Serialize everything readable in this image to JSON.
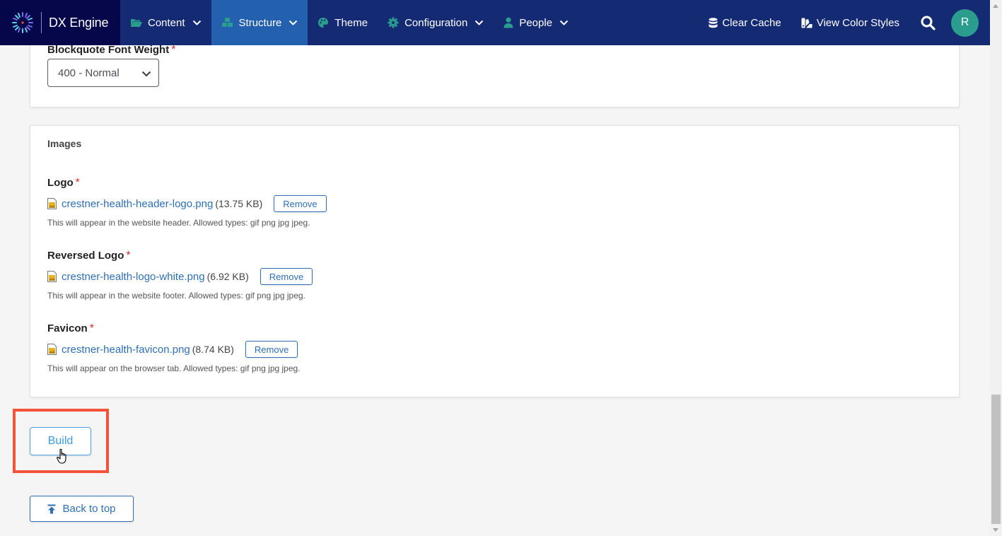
{
  "nav": {
    "brand": "DX Engine",
    "items": [
      {
        "label": "Content",
        "icon": "folder-open-icon",
        "has_dropdown": true,
        "active": false
      },
      {
        "label": "Structure",
        "icon": "cubes-icon",
        "has_dropdown": true,
        "active": true
      },
      {
        "label": "Theme",
        "icon": "palette-icon",
        "has_dropdown": false,
        "active": false
      },
      {
        "label": "Configuration",
        "icon": "gear-icon",
        "has_dropdown": true,
        "active": false
      },
      {
        "label": "People",
        "icon": "user-icon",
        "has_dropdown": true,
        "active": false
      }
    ],
    "clear_cache": "Clear Cache",
    "view_color_styles": "View Color Styles",
    "avatar_initial": "R"
  },
  "colors": {
    "nav_bg": "#142a73",
    "brand_bg": "#06064a",
    "active_nav": "#2360ad",
    "icon_teal": "#2a9d8f",
    "link_blue": "#2e6fb5",
    "required_red": "#d32f2f",
    "highlight_red": "#f4533a"
  },
  "typography_panel": {
    "blockquote_weight_label": "Blockquote Font Weight",
    "blockquote_weight_value": "400 - Normal"
  },
  "images": {
    "title": "Images",
    "fields": [
      {
        "label": "Logo",
        "file_name": "crestner-health-header-logo.png",
        "file_size": "(13.75 KB)",
        "remove_label": "Remove",
        "help": "This will appear in the website header. Allowed types: gif png jpg jpeg."
      },
      {
        "label": "Reversed Logo",
        "file_name": "crestner-health-logo-white.png",
        "file_size": "(6.92 KB)",
        "remove_label": "Remove",
        "help": "This will appear in the website footer. Allowed types: gif png jpg jpeg."
      },
      {
        "label": "Favicon",
        "file_name": "crestner-health-favicon.png",
        "file_size": "(8.74 KB)",
        "remove_label": "Remove",
        "help": "This will appear on the browser tab. Allowed types: gif png jpg jpeg."
      }
    ]
  },
  "actions": {
    "build_label": "Build",
    "back_to_top_label": "Back to top"
  },
  "required_marker": "*"
}
